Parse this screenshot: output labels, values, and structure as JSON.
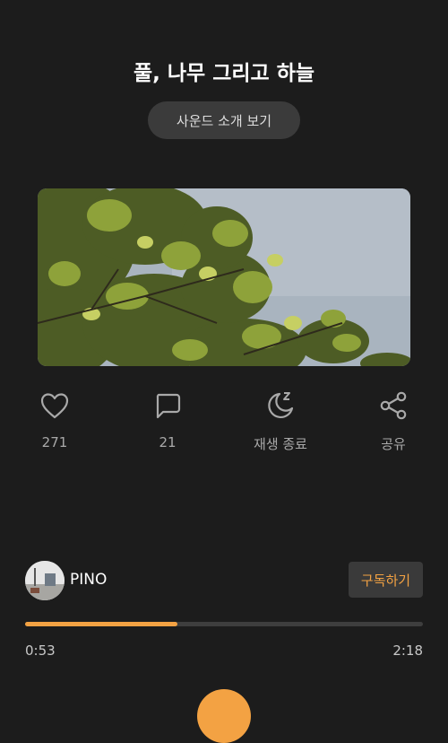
{
  "track": {
    "title": "풀, 나무 그리고 하늘",
    "intro_button": "사운드 소개 보기",
    "cover_image": "tree-canopy-against-sky"
  },
  "actions": {
    "like": {
      "icon": "heart-icon",
      "count": "271"
    },
    "comment": {
      "icon": "comment-icon",
      "count": "21"
    },
    "sleep_timer": {
      "icon": "moon-zzz-icon",
      "label": "재생 종료"
    },
    "share": {
      "icon": "share-icon",
      "label": "공유"
    }
  },
  "artist": {
    "name": "PINO",
    "subscribe_label": "구독하기"
  },
  "player": {
    "current_time": "0:53",
    "total_time": "2:18",
    "progress_fraction": 0.384
  },
  "colors": {
    "background": "#1c1c1c",
    "accent": "#f3a243",
    "muted_text": "#a9a9a9"
  }
}
